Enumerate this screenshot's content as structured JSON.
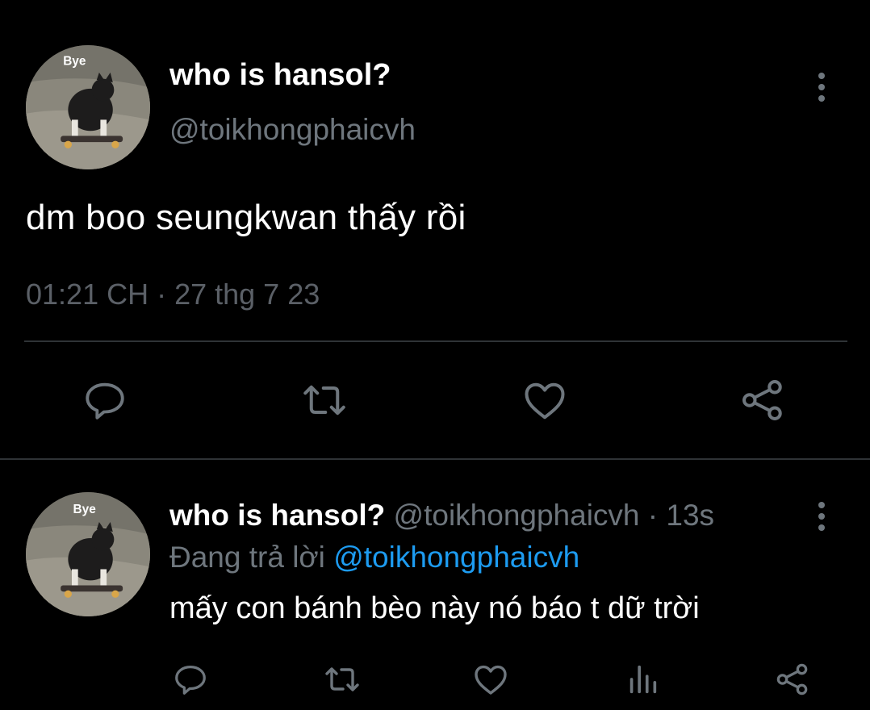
{
  "colors": {
    "background": "#000000",
    "text_primary": "#ffffff",
    "text_secondary": "#6e767d",
    "divider": "#2f3336",
    "mention_link": "#1d9bf0"
  },
  "main_tweet": {
    "avatar_caption": "Bye",
    "display_name": "who is hansol?",
    "handle": "@toikhongphaicvh",
    "text": "dm boo seungkwan thấy rồi",
    "timestamp": "01:21 CH · 27 thg 7 23",
    "actions": [
      "reply-icon",
      "retweet-icon",
      "like-icon",
      "share-icon"
    ]
  },
  "reply_tweet": {
    "avatar_caption": "Bye",
    "display_name": "who is hansol?",
    "handle": "@toikhongphaicvh",
    "separator": " · ",
    "time_ago": "13s",
    "replying_to_label": "Đang trả lời ",
    "replying_to_handle": "@toikhongphaicvh",
    "text": "mấy con bánh bèo này nó báo t dữ trời",
    "actions": [
      "reply-icon",
      "retweet-icon",
      "like-icon",
      "analytics-icon",
      "share-icon"
    ]
  }
}
